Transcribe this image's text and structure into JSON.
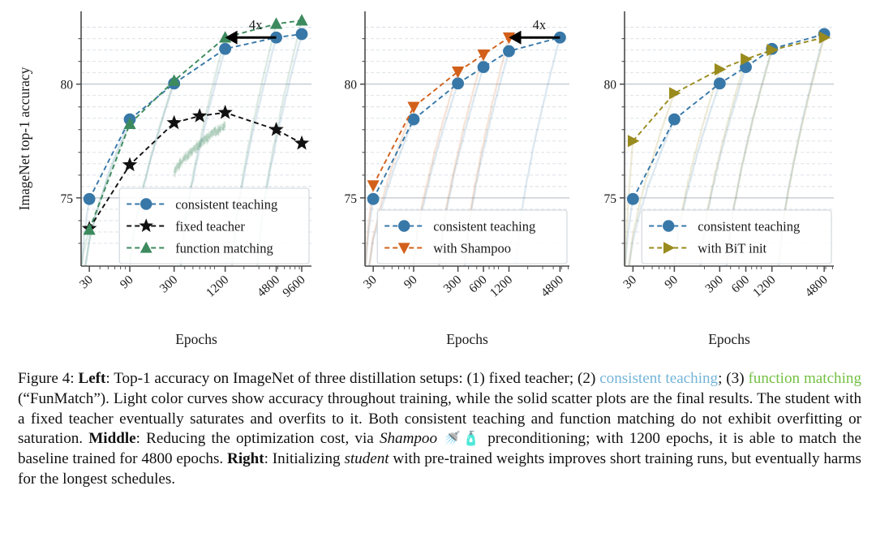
{
  "figure": {
    "label": "Figure 4",
    "axis": {
      "ylabel": "ImageNet top-1 accuracy",
      "xlabel": "Epochs",
      "yticks": [
        75,
        80
      ],
      "ylim": [
        72.0,
        83.2
      ],
      "gridlines": [
        73.0,
        73.5,
        74.0,
        74.5,
        75.0,
        75.5,
        76.0,
        76.5,
        77.0,
        77.5,
        78.0,
        78.5,
        79.0,
        79.5,
        80.0,
        80.5,
        81.0,
        81.5,
        82.0,
        82.5
      ],
      "major_gridlines": [
        75.0,
        80.0
      ]
    },
    "colors": {
      "consistent": "#3878a8",
      "fixed": "#111111",
      "funmatch": "#3d8a5e",
      "shampoo": "#d2601a",
      "bit": "#9a8b1e",
      "grid": "#c8ced6",
      "axis": "#4a4a4a",
      "legend_border": "#cfd4da",
      "caption_consistent": "#74b4d8",
      "caption_funmatch": "#74c043"
    },
    "annotation": {
      "label": "4x"
    }
  },
  "chart_data": [
    {
      "type": "line",
      "name": "left",
      "title": "Left",
      "xlabel": "Epochs",
      "ylabel": "ImageNet top-1 accuracy",
      "xscale": "log",
      "xticks": [
        30,
        90,
        300,
        1200,
        4800,
        9600
      ],
      "xticklabels": [
        "30",
        "90",
        "300",
        "1200",
        "4800",
        "9600"
      ],
      "xlim": [
        24,
        12500
      ],
      "ylim": [
        72.0,
        83.2
      ],
      "yticks": [
        75,
        80
      ],
      "grid": true,
      "legend_position": "lower-right",
      "annotation": {
        "text": "4x",
        "from_x": 4800,
        "to_x": 1200,
        "y": 82.05
      },
      "series": [
        {
          "name": "consistent teaching",
          "color": "#3878a8",
          "marker": "circle",
          "linestyle": "dashed",
          "x": [
            30,
            90,
            300,
            1200,
            4800,
            9600
          ],
          "values": [
            74.95,
            78.45,
            80.03,
            81.55,
            82.05,
            82.2
          ]
        },
        {
          "name": "fixed teacher",
          "color": "#111111",
          "marker": "star",
          "linestyle": "dashed",
          "x": [
            30,
            90,
            300,
            600,
            1200,
            4800,
            9600
          ],
          "values": [
            73.65,
            76.45,
            78.3,
            78.6,
            78.75,
            78.0,
            77.4
          ]
        },
        {
          "name": "function matching",
          "color": "#3d8a5e",
          "marker": "triangle-up",
          "linestyle": "dashed",
          "x": [
            30,
            90,
            300,
            1200,
            4800,
            9600
          ],
          "values": [
            73.6,
            78.25,
            80.15,
            82.05,
            82.65,
            82.8
          ]
        }
      ],
      "light_curves": [
        {
          "color": "#3878a8",
          "end_x": 30,
          "end_y": 74.95
        },
        {
          "color": "#3878a8",
          "end_x": 90,
          "end_y": 78.45
        },
        {
          "color": "#3878a8",
          "end_x": 300,
          "end_y": 80.03
        },
        {
          "color": "#3878a8",
          "end_x": 1200,
          "end_y": 81.55
        },
        {
          "color": "#3878a8",
          "end_x": 4800,
          "end_y": 82.05
        },
        {
          "color": "#3878a8",
          "end_x": 9600,
          "end_y": 82.2
        },
        {
          "color": "#3d8a5e",
          "end_x": 30,
          "end_y": 73.6
        },
        {
          "color": "#3d8a5e",
          "end_x": 90,
          "end_y": 78.25
        },
        {
          "color": "#3d8a5e",
          "end_x": 300,
          "end_y": 80.15
        },
        {
          "color": "#3d8a5e",
          "end_x": 1200,
          "end_y": 82.05
        },
        {
          "color": "#3d8a5e",
          "end_x": 4800,
          "end_y": 82.65
        },
        {
          "color": "#3d8a5e",
          "end_x": 9600,
          "end_y": 82.8
        }
      ],
      "noisy_band": {
        "color": "#3d8a5e",
        "x_start": 300,
        "x_end": 1200,
        "y_start": 76.0,
        "y_end": 78.2
      }
    },
    {
      "type": "line",
      "name": "middle",
      "title": "Middle",
      "xlabel": "Epochs",
      "ylabel": "",
      "xscale": "log",
      "xticks": [
        30,
        90,
        300,
        600,
        1200,
        4800
      ],
      "xticklabels": [
        "30",
        "90",
        "300",
        "600",
        "1200",
        "4800"
      ],
      "xlim": [
        24,
        6200
      ],
      "ylim": [
        72.0,
        83.2
      ],
      "yticks": [
        75,
        80
      ],
      "grid": true,
      "legend_position": "lower-right",
      "annotation": {
        "text": "4x",
        "from_x": 4800,
        "to_x": 1200,
        "y": 82.05
      },
      "series": [
        {
          "name": "consistent teaching",
          "color": "#3878a8",
          "marker": "circle",
          "linestyle": "dashed",
          "x": [
            30,
            90,
            300,
            600,
            1200,
            4800
          ],
          "values": [
            74.95,
            78.45,
            80.03,
            80.75,
            81.45,
            82.05
          ]
        },
        {
          "name": "with Shampoo",
          "color": "#d2601a",
          "marker": "triangle-down",
          "linestyle": "dashed",
          "x": [
            30,
            90,
            300,
            600,
            1200
          ],
          "values": [
            75.55,
            79.0,
            80.55,
            81.3,
            82.05
          ]
        }
      ],
      "light_curves": [
        {
          "color": "#3878a8",
          "end_x": 30,
          "end_y": 74.95
        },
        {
          "color": "#3878a8",
          "end_x": 90,
          "end_y": 78.45
        },
        {
          "color": "#3878a8",
          "end_x": 300,
          "end_y": 80.03
        },
        {
          "color": "#3878a8",
          "end_x": 600,
          "end_y": 80.75
        },
        {
          "color": "#3878a8",
          "end_x": 1200,
          "end_y": 81.45
        },
        {
          "color": "#3878a8",
          "end_x": 4800,
          "end_y": 82.05
        },
        {
          "color": "#d2601a",
          "end_x": 30,
          "end_y": 75.55
        },
        {
          "color": "#d2601a",
          "end_x": 90,
          "end_y": 79.0
        },
        {
          "color": "#d2601a",
          "end_x": 300,
          "end_y": 80.55
        },
        {
          "color": "#d2601a",
          "end_x": 600,
          "end_y": 81.3
        },
        {
          "color": "#d2601a",
          "end_x": 1200,
          "end_y": 82.05
        }
      ]
    },
    {
      "type": "line",
      "name": "right",
      "title": "Right",
      "xlabel": "Epochs",
      "ylabel": "",
      "xscale": "log",
      "xticks": [
        30,
        90,
        300,
        600,
        1200,
        4800
      ],
      "xticklabels": [
        "30",
        "90",
        "300",
        "600",
        "1200",
        "4800"
      ],
      "xlim": [
        24,
        6200
      ],
      "ylim": [
        72.0,
        83.2
      ],
      "yticks": [
        75,
        80
      ],
      "grid": true,
      "legend_position": "lower-right",
      "annotation": null,
      "series": [
        {
          "name": "consistent teaching",
          "color": "#3878a8",
          "marker": "circle",
          "linestyle": "dashed",
          "x": [
            30,
            90,
            300,
            600,
            1200,
            4800
          ],
          "values": [
            74.95,
            78.45,
            80.03,
            80.75,
            81.55,
            82.2
          ]
        },
        {
          "name": "with BiT init",
          "color": "#9a8b1e",
          "marker": "triangle-right",
          "linestyle": "dashed",
          "x": [
            30,
            90,
            300,
            600,
            1200,
            4800
          ],
          "values": [
            77.5,
            79.6,
            80.65,
            81.1,
            81.5,
            82.05
          ]
        }
      ],
      "light_curves": [
        {
          "color": "#3878a8",
          "end_x": 30,
          "end_y": 74.95
        },
        {
          "color": "#3878a8",
          "end_x": 90,
          "end_y": 78.45
        },
        {
          "color": "#3878a8",
          "end_x": 300,
          "end_y": 80.03
        },
        {
          "color": "#3878a8",
          "end_x": 600,
          "end_y": 80.75
        },
        {
          "color": "#3878a8",
          "end_x": 1200,
          "end_y": 81.55
        },
        {
          "color": "#3878a8",
          "end_x": 4800,
          "end_y": 82.2
        },
        {
          "color": "#9a8b1e",
          "end_x": 30,
          "end_y": 77.5
        },
        {
          "color": "#9a8b1e",
          "end_x": 90,
          "end_y": 79.6
        },
        {
          "color": "#9a8b1e",
          "end_x": 300,
          "end_y": 80.65
        },
        {
          "color": "#9a8b1e",
          "end_x": 600,
          "end_y": 81.1
        },
        {
          "color": "#9a8b1e",
          "end_x": 1200,
          "end_y": 81.5
        },
        {
          "color": "#9a8b1e",
          "end_x": 4800,
          "end_y": 82.05
        }
      ]
    }
  ],
  "caption": {
    "parts": [
      {
        "text": "Figure 4: ",
        "style": "normal"
      },
      {
        "text": "Left",
        "style": "bold"
      },
      {
        "text": ": Top-1 accuracy on ImageNet of three distillation setups: (1) fixed teacher; (2) ",
        "style": "normal"
      },
      {
        "text": "consistent teaching",
        "style": "color-consistent"
      },
      {
        "text": "; (3) ",
        "style": "normal"
      },
      {
        "text": "function matching",
        "style": "color-funmatch"
      },
      {
        "text": " (“FunMatch”). Light color curves show accuracy throughout training, while the solid scatter plots are the final results. The student with a fixed teacher eventually saturates and overfits to it. Both consistent teaching and function matching do not exhibit overfitting or saturation. ",
        "style": "normal"
      },
      {
        "text": "Middle",
        "style": "bold"
      },
      {
        "text": ": Reducing the optimization cost, via ",
        "style": "normal"
      },
      {
        "text": "Shampoo",
        "style": "italic"
      },
      {
        "text": " 🚿🧴",
        "style": "emoji"
      },
      {
        "text": " preconditioning; with 1200 epochs, it is able to match the baseline trained for 4800 epochs. ",
        "style": "normal"
      },
      {
        "text": "Right",
        "style": "bold"
      },
      {
        "text": ": Initializing ",
        "style": "normal"
      },
      {
        "text": "student",
        "style": "italic"
      },
      {
        "text": " with pre-trained weights improves short training runs, but eventually harms for the longest schedules.",
        "style": "normal"
      }
    ]
  }
}
